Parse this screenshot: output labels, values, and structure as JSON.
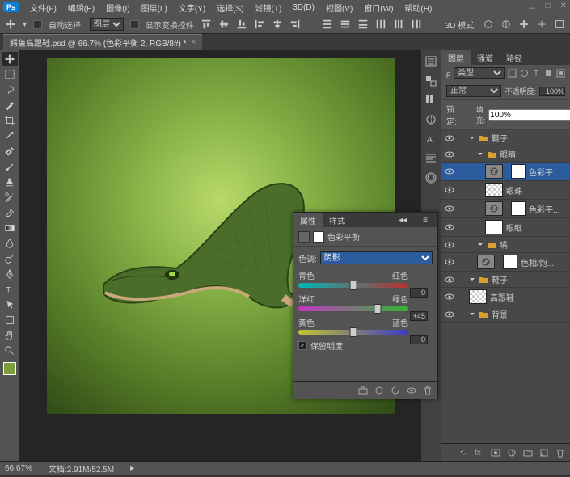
{
  "menu": {
    "items": [
      "文件(F)",
      "编辑(E)",
      "图像(I)",
      "图层(L)",
      "文字(Y)",
      "选择(S)",
      "滤镜(T)",
      "3D(D)",
      "视图(V)",
      "窗口(W)",
      "帮助(H)"
    ]
  },
  "optbar": {
    "autoSelect": "自动选择:",
    "autoTarget": "图层",
    "showTransform": "显示变换控件",
    "threeDMode": "3D 模式:"
  },
  "doc": {
    "tab": "鳄鱼高跟鞋.psd @ 66.7% (色彩平衡 2, RGB/8#) *"
  },
  "layersPanel": {
    "tabs": {
      "layers": "图层",
      "channels": "通道",
      "paths": "路径"
    },
    "kind": "类型",
    "blend": "正常",
    "opacityLbl": "不透明度:",
    "opacityVal": "100%",
    "lockLbl": "锁定:",
    "fillLbl": "填充:",
    "fillVal": "100%",
    "layers": [
      {
        "name": "鞋子",
        "type": "group",
        "indent": 1
      },
      {
        "name": "眼睛",
        "type": "group",
        "indent": 2
      },
      {
        "name": "色彩平...",
        "type": "adj",
        "indent": 3,
        "sel": true
      },
      {
        "name": "眼珠",
        "type": "layer",
        "indent": 3,
        "chk": true
      },
      {
        "name": "色彩平...",
        "type": "adj",
        "indent": 3
      },
      {
        "name": "眼眶",
        "type": "layer",
        "indent": 3
      },
      {
        "name": "嘴",
        "type": "group",
        "indent": 2
      },
      {
        "name": "色相/饱...",
        "type": "adj",
        "indent": 2
      },
      {
        "name": "鞋子",
        "type": "group",
        "indent": 1
      },
      {
        "name": "高跟鞋",
        "type": "layer",
        "indent": 1,
        "chk": true
      },
      {
        "name": "背景",
        "type": "group",
        "indent": 1
      }
    ]
  },
  "props": {
    "tabs": {
      "properties": "属性",
      "styles": "样式"
    },
    "title": "色彩平衡",
    "toneLbl": "色调:",
    "tone": "阴影",
    "sliders": [
      {
        "l": "青色",
        "r": "红色",
        "v": "0",
        "pos": 50,
        "g": "linear-gradient(90deg,#00b7b7,#b73030)"
      },
      {
        "l": "洋红",
        "r": "绿色",
        "v": "+45",
        "pos": 72,
        "g": "linear-gradient(90deg,#c436c4,#2fb72f)"
      },
      {
        "l": "黄色",
        "r": "蓝色",
        "v": "0",
        "pos": 50,
        "g": "linear-gradient(90deg,#c4c430,#3a3ac4)"
      }
    ],
    "preserve": "保留明度"
  },
  "status": {
    "zoom": "66.67%",
    "docsize": "文档:2.91M/52.5M"
  }
}
